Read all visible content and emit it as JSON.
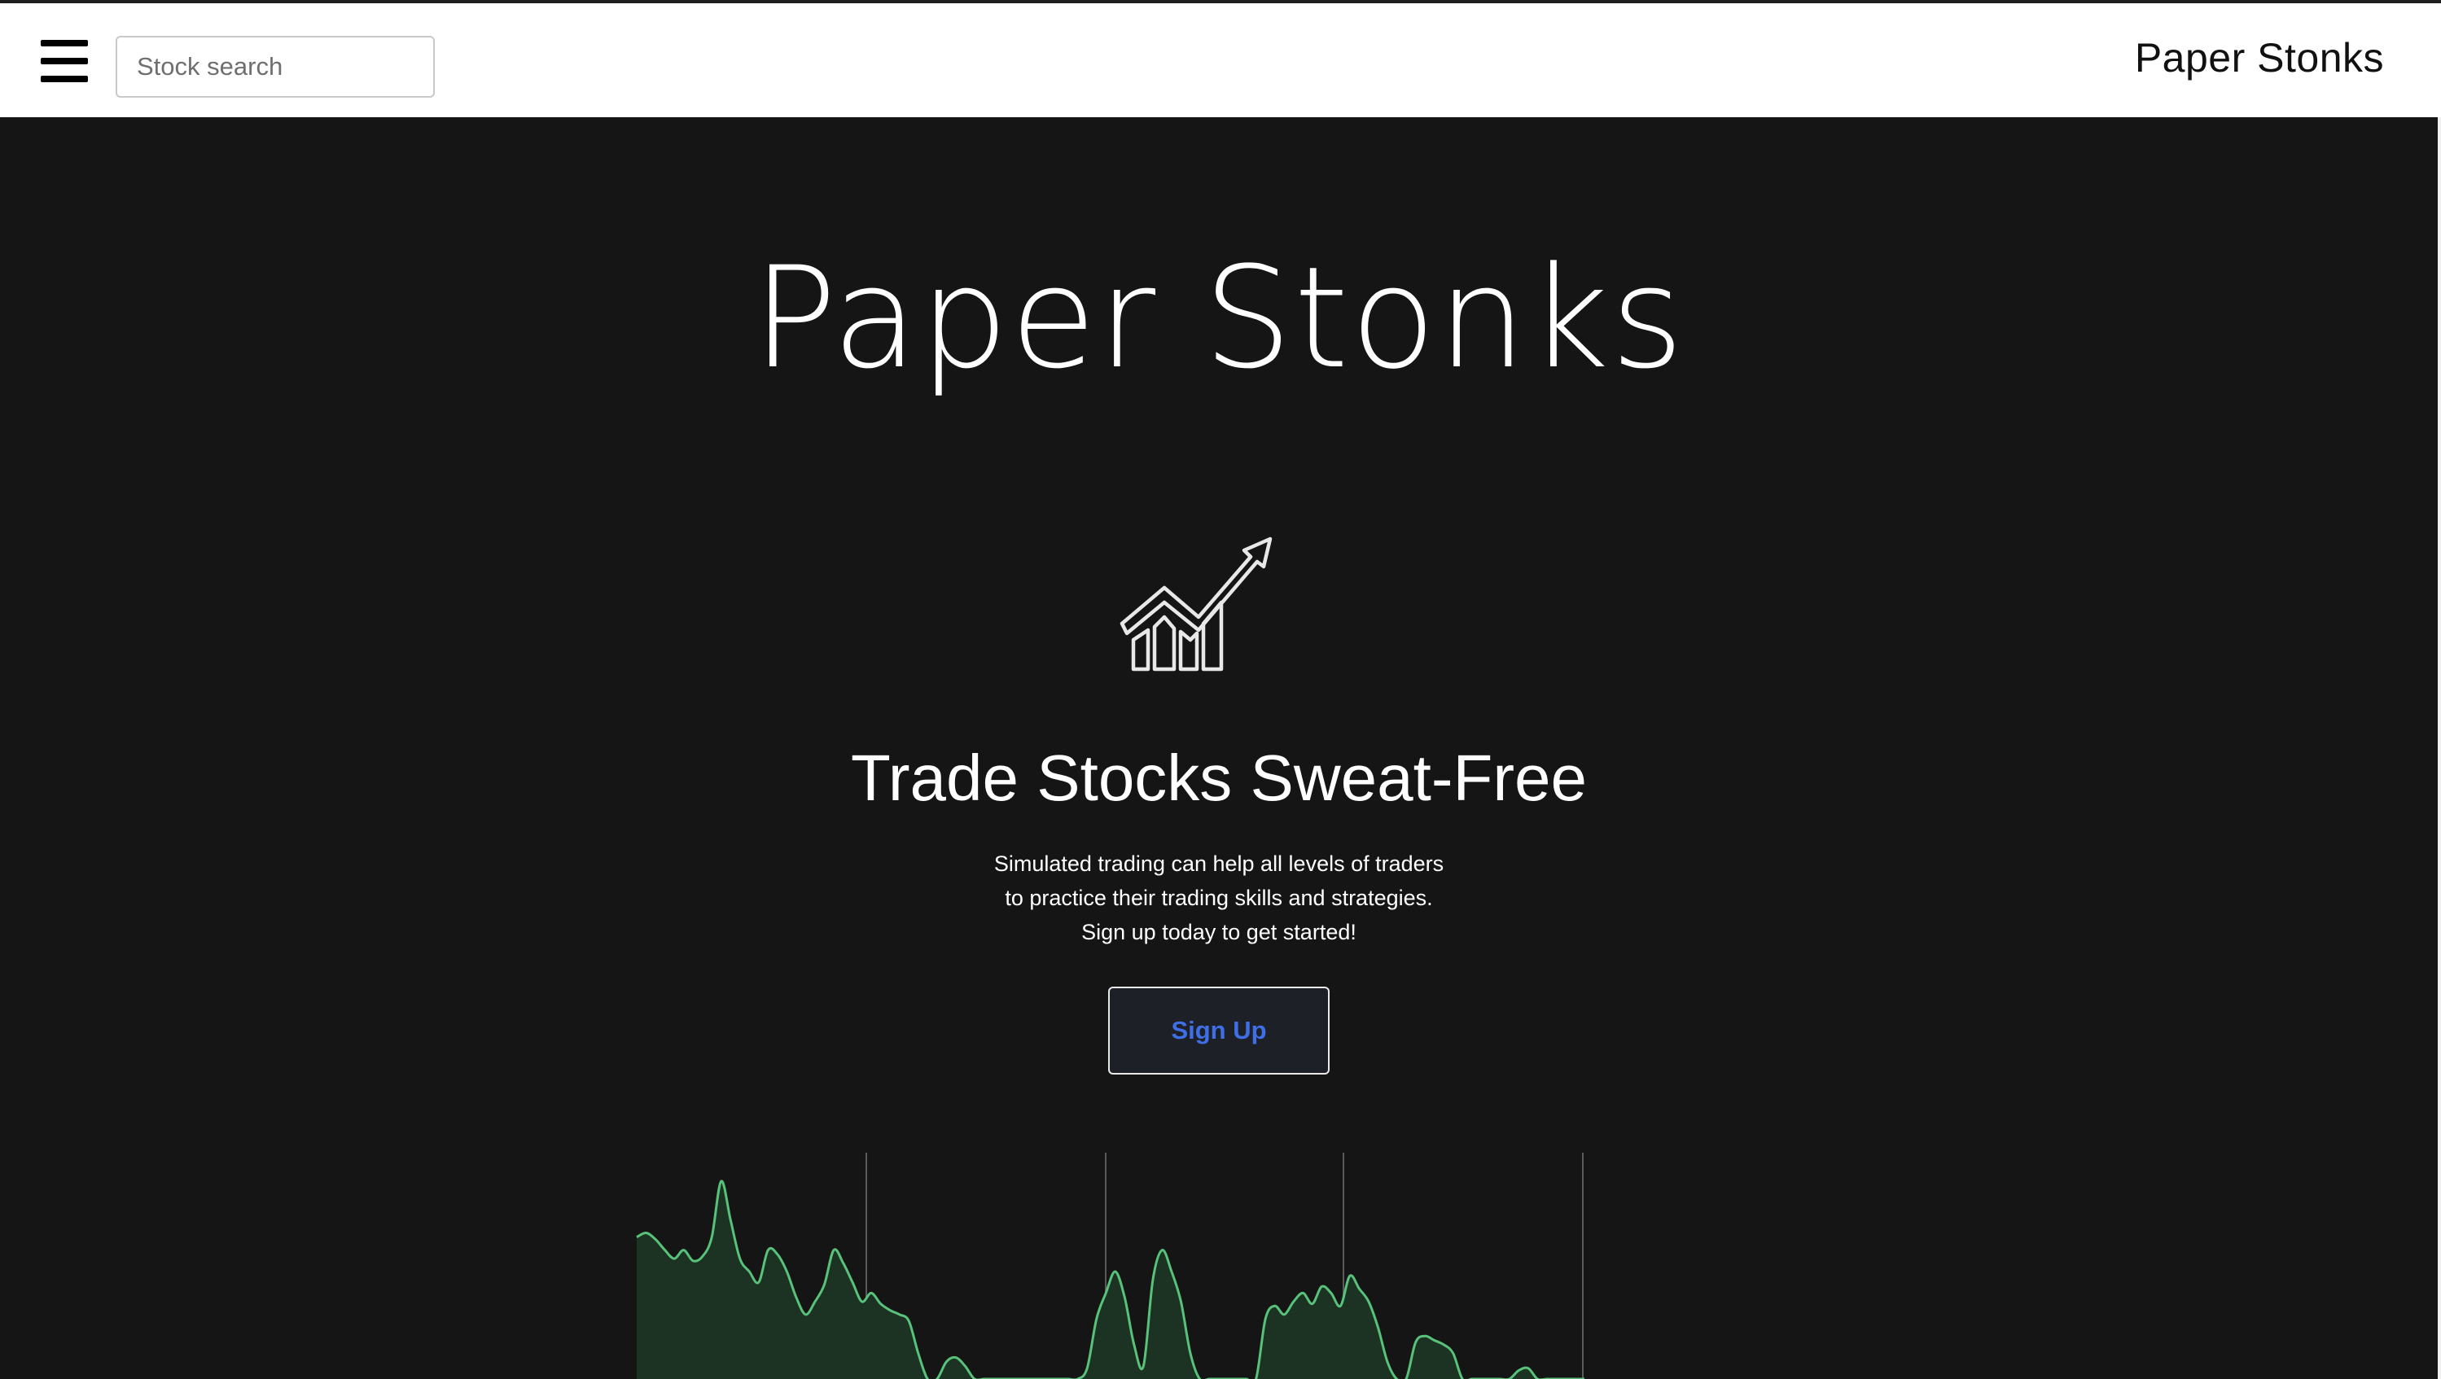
{
  "header": {
    "menu_icon": "hamburger-menu-icon",
    "search_placeholder": "Stock search",
    "brand": "Paper Stonks"
  },
  "hero": {
    "title": "Paper Stonks",
    "logo_icon": "growth-chart-arrow-icon",
    "subtitle": "Trade Stocks Sweat-Free",
    "description_lines": [
      "Simulated trading can help all levels of traders",
      "to practice their trading skills and strategies.",
      "Sign up today to get started!"
    ],
    "signup_label": "Sign Up"
  },
  "chart_data": {
    "type": "area",
    "title": "",
    "xlabel": "",
    "ylabel": "",
    "grid": true,
    "series": [
      {
        "values": [
          0.66,
          0.68,
          0.65,
          0.6,
          0.56,
          0.6,
          0.55,
          0.57,
          0.66,
          0.92,
          0.74,
          0.56,
          0.5,
          0.45,
          0.6,
          0.58,
          0.5,
          0.38,
          0.3,
          0.36,
          0.44,
          0.6,
          0.54,
          0.45,
          0.36,
          0.4,
          0.35,
          0.32,
          0.3,
          0.27,
          0.12,
          0.0,
          0.0,
          0.08,
          0.1,
          0.06,
          0.0,
          0.0,
          0.0,
          0.0,
          0.0,
          0.0,
          0.0,
          0.0,
          0.0,
          0.0,
          0.0,
          0.0,
          0.05,
          0.28,
          0.4,
          0.5,
          0.38,
          0.16,
          0.06,
          0.46,
          0.6,
          0.5,
          0.36,
          0.12,
          0.0,
          0.0,
          0.0,
          0.0,
          0.0,
          0.0,
          0.0,
          0.28,
          0.34,
          0.3,
          0.36,
          0.4,
          0.35,
          0.43,
          0.4,
          0.34,
          0.48,
          0.42,
          0.36,
          0.24,
          0.08,
          0.0,
          0.0,
          0.17,
          0.2,
          0.18,
          0.16,
          0.12,
          0.0,
          0.0,
          0.0,
          0.0,
          0.0,
          0.0,
          0.04,
          0.05,
          0.0,
          0.0,
          0.0,
          0.0,
          0.0,
          0.0
        ]
      }
    ],
    "colors": {
      "line": "#58c27a",
      "fill": "#1c3324",
      "grid": "#5a5a5a"
    }
  }
}
